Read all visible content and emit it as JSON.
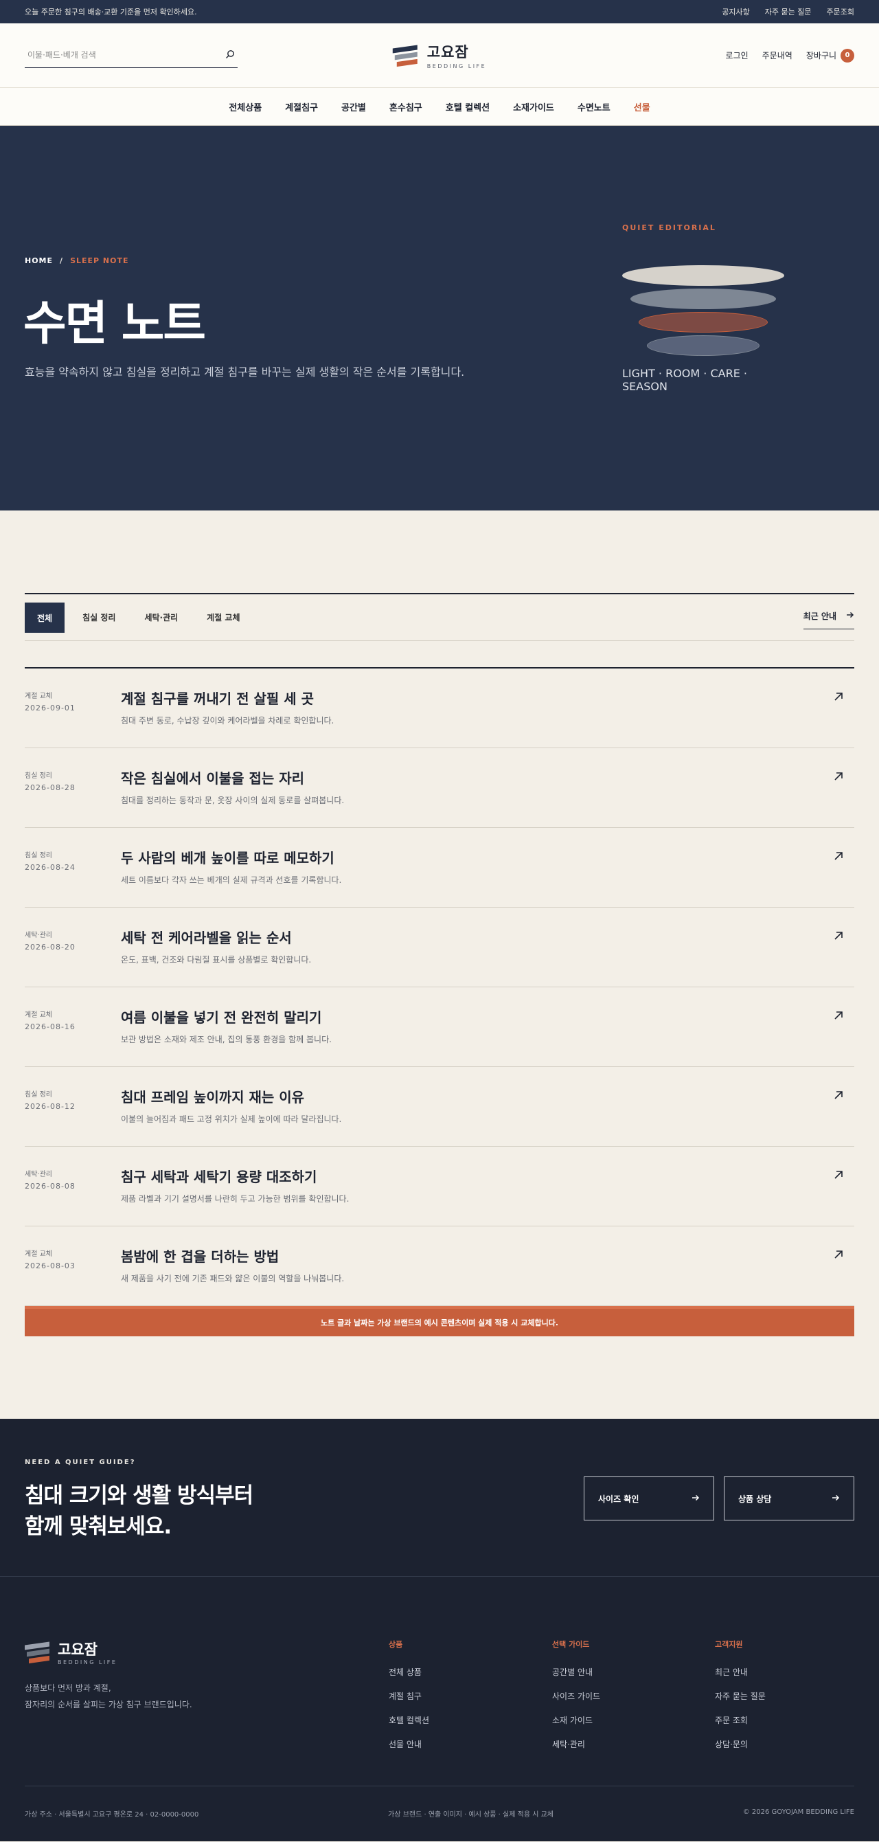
{
  "topbar": {
    "notice": "오늘 주문한 침구의 배송·교환 기준을 먼저 확인하세요.",
    "links": [
      "공지사항",
      "자주 묻는 질문",
      "주문조회"
    ]
  },
  "header": {
    "search_placeholder": "이불·패드·베개 검색",
    "brand": "고요잠",
    "brand_sub": "BEDDING LIFE",
    "login": "로그인",
    "orders": "주문내역",
    "cart": "장바구니",
    "cart_count": "0"
  },
  "nav": {
    "items": [
      "전체상품",
      "계절침구",
      "공간별",
      "혼수침구",
      "호텔 컬렉션",
      "소재가이드",
      "수면노트",
      "선물"
    ],
    "accent_color": "#c75f3c"
  },
  "hero": {
    "crumb_home": "HOME",
    "crumb_sep": "/",
    "crumb_current": "SLEEP NOTE",
    "title": "수면 노트",
    "description": "효능을 약속하지 않고 침실을 정리하고 계절 침구를 바꾸는 실제 생활의 작은 순서를 기록합니다.",
    "editorial_label": "QUIET EDITORIAL",
    "editorial_caption": "LIGHT · ROOM · CARE · SEASON"
  },
  "tabs": {
    "items": [
      "전체",
      "침실 정리",
      "세탁·관리",
      "계절 교체"
    ],
    "recent": "최근 안내"
  },
  "posts": [
    {
      "category": "계절 교체",
      "date": "2026-09-01",
      "title": "계절 침구를 꺼내기 전 살필 세 곳",
      "summary": "침대 주변 동로, 수납장 깊이와 케어라벨을 차례로 확인합니다."
    },
    {
      "category": "침실 정리",
      "date": "2026-08-28",
      "title": "작은 침실에서 이불을 접는 자리",
      "summary": "침대를 정리하는 동작과 문, 옷장 사이의 실제 동로를 살펴봅니다."
    },
    {
      "category": "침실 정리",
      "date": "2026-08-24",
      "title": "두 사람의 베개 높이를 따로 메모하기",
      "summary": "세트 이름보다 각자 쓰는 베개의 실제 규격과 선호를 기록합니다."
    },
    {
      "category": "세탁·관리",
      "date": "2026-08-20",
      "title": "세탁 전 케어라벨을 읽는 순서",
      "summary": "온도, 표백, 건조와 다림질 표시를 상품별로 확인합니다."
    },
    {
      "category": "계절 교체",
      "date": "2026-08-16",
      "title": "여름 이불을 넣기 전 완전히 말리기",
      "summary": "보관 방법은 소재와 제조 안내, 집의 통풍 환경을 함께 봅니다."
    },
    {
      "category": "침실 정리",
      "date": "2026-08-12",
      "title": "침대 프레임 높이까지 재는 이유",
      "summary": "이불의 늘어짐과 패드 고정 위치가 실제 높이에 따라 달라집니다."
    },
    {
      "category": "세탁·관리",
      "date": "2026-08-08",
      "title": "침구 세탁과 세탁기 용량 대조하기",
      "summary": "제품 라벨과 기기 설명서를 나란히 두고 가능한 범위를 확인합니다."
    },
    {
      "category": "계절 교체",
      "date": "2026-08-03",
      "title": "봄밤에 한 겹을 더하는 방법",
      "summary": "새 제품을 사기 전에 기존 패드와 얇은 이불의 역할을 나눠봅니다."
    }
  ],
  "notice_bar": "노트 글과 날짜는 가상 브랜드의 예시 콘텐츠이며 실제 적용 시 교체합니다.",
  "cta": {
    "kicker": "NEED A QUIET GUIDE?",
    "title_line1": "침대 크기와 생활 방식부터",
    "title_line2": "함께 맞춰보세요.",
    "button1": "사이즈 확인",
    "button2": "상품 상담"
  },
  "footer": {
    "brand": "고요잠",
    "brand_sub": "BEDDING LIFE",
    "desc_line1": "상품보다 먼저 방과 계절,",
    "desc_line2": "잠자리의 순서를 살피는 가상 침구 브랜드입니다.",
    "columns": [
      {
        "heading": "상품",
        "links": [
          "전체 상품",
          "계절 침구",
          "호텔 컬렉션",
          "선물 안내"
        ]
      },
      {
        "heading": "선택 가이드",
        "links": [
          "공간별 안내",
          "사이즈 가이드",
          "소재 가이드",
          "세탁·관리"
        ]
      },
      {
        "heading": "고객지원",
        "links": [
          "최근 안내",
          "자주 묻는 질문",
          "주문 조회",
          "상담·문의"
        ]
      }
    ],
    "address": "가상 주소 · 서울특별시 고요구 평온로 24 · 02-0000-0000",
    "disclaimer": "가상 브랜드 · 연출 이미지 · 예시 상품 · 실제 적용 시 교체",
    "copyright": "© 2026 GOYOJAM BEDDING LIFE"
  }
}
